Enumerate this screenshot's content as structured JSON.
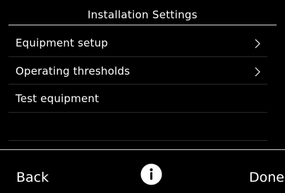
{
  "header": {
    "title": "Installation Settings"
  },
  "menu": {
    "items": [
      {
        "label": "Equipment setup",
        "icon": "chevron-right-icon"
      },
      {
        "label": "Operating thresholds",
        "icon": "chevron-right-icon"
      },
      {
        "label": "Test equipment"
      }
    ]
  },
  "footer": {
    "back_label": "Back",
    "done_label": "Done",
    "info_icon": "info-icon"
  },
  "colors": {
    "background": "#000000",
    "text": "#ffffff",
    "divider": "#2a2a2a"
  }
}
